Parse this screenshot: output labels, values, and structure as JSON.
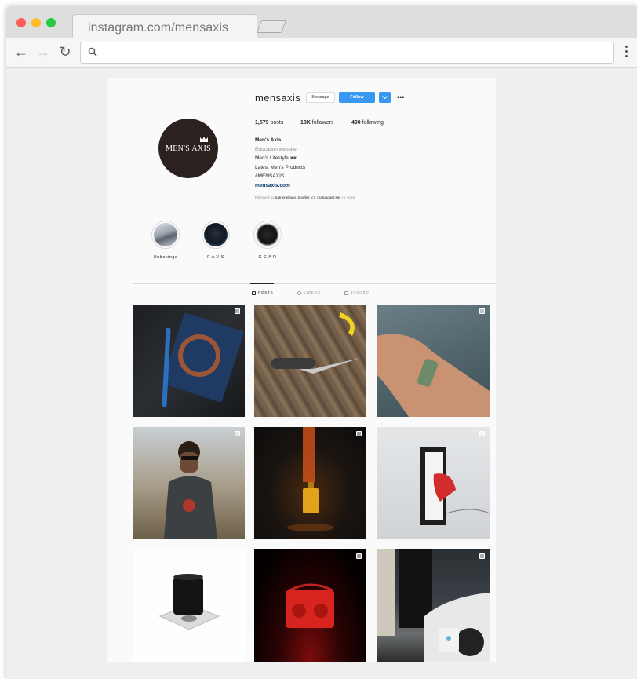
{
  "browser": {
    "tab_title": "instagram.com/mensaxis",
    "address": ""
  },
  "profile": {
    "avatar_text": "MEN'S AXIS",
    "username": "mensaxis",
    "message_label": "Message",
    "follow_label": "Follow",
    "more_label": "•••",
    "posts_count": "1,579",
    "posts_label": "posts",
    "followers_count": "18K",
    "followers_label": "followers",
    "following_count": "490",
    "following_label": "following",
    "bio_name": "Men's Axis",
    "bio_category": "Education website",
    "bio_line1": "Men's Lifestyle 🕶",
    "bio_line2": "Latest Men's Products",
    "bio_line3": "#MENSAXIS",
    "bio_link": "mensaxis.com",
    "followed_prefix": "Followed by",
    "followed_names": "patrastellano, toodles_c7, thatgadget.ser",
    "followed_more": "+1 more"
  },
  "highlights": [
    {
      "label": "Unboxings"
    },
    {
      "label": "F A V S"
    },
    {
      "label": "G E A R"
    }
  ],
  "profile_tabs": [
    {
      "label": "POSTS",
      "icon": "grid-icon"
    },
    {
      "label": "VIDEOS",
      "icon": "video-icon"
    },
    {
      "label": "TAGGED",
      "icon": "tag-icon"
    }
  ],
  "posts": [
    {
      "subject": "notebook-and-pen",
      "multi": true
    },
    {
      "subject": "knife-on-wood",
      "multi": false
    },
    {
      "subject": "wrist-wearable",
      "multi": true
    },
    {
      "subject": "man-with-sunglasses",
      "multi": true
    },
    {
      "subject": "fragrance-bottle",
      "multi": true
    },
    {
      "subject": "levitating-sneaker",
      "multi": true
    },
    {
      "subject": "black-speaker-cube",
      "multi": false
    },
    {
      "subject": "red-radio-speaker",
      "multi": true
    },
    {
      "subject": "electric-car-charger",
      "multi": true
    }
  ]
}
